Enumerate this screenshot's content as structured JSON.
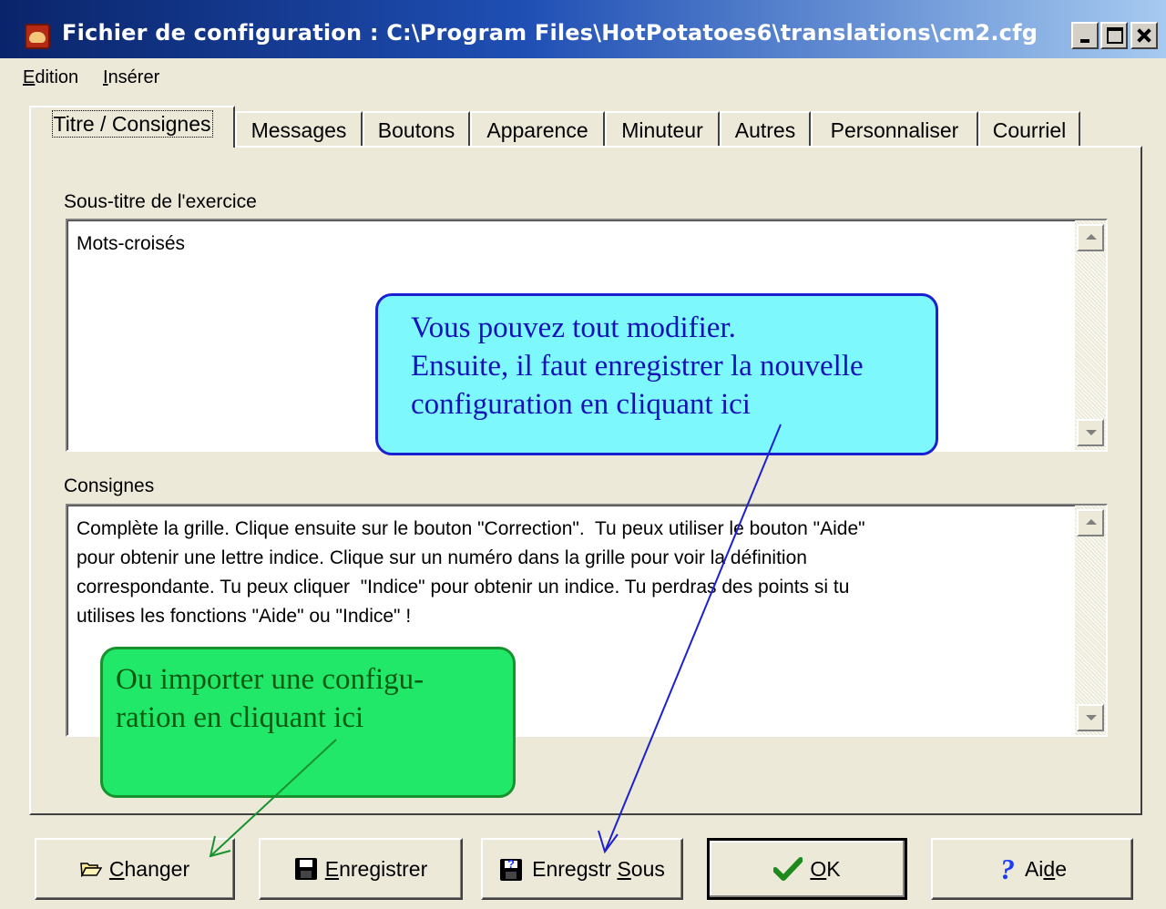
{
  "window": {
    "title": "Fichier de configuration : C:\\Program Files\\HotPotatoes6\\translations\\cm2.cfg"
  },
  "menu": {
    "items": [
      {
        "accel": "E",
        "rest": "dition"
      },
      {
        "accel": "I",
        "rest": "nsérer"
      }
    ]
  },
  "tabs": [
    {
      "label": "Titre / Consignes",
      "active": true
    },
    {
      "label": "Messages"
    },
    {
      "label": "Boutons"
    },
    {
      "label": "Apparence"
    },
    {
      "label": "Minuteur"
    },
    {
      "label": "Autres"
    },
    {
      "label": "Personnaliser"
    },
    {
      "label": "Courriel"
    }
  ],
  "subtitle": {
    "label": "Sous-titre de l'exercice",
    "value": "Mots-croisés"
  },
  "instructions": {
    "label": "Consignes",
    "value": "Complète la grille. Clique ensuite sur le bouton \"Correction\".  Tu peux utiliser le bouton \"Aide\"\npour obtenir une lettre indice. Clique sur un numéro dans la grille pour voir la définition\ncorrespondante. Tu peux cliquer  \"Indice\" pour obtenir un indice. Tu perdras des points si tu\nutilises les fonctions \"Aide\" ou \"Indice\" !"
  },
  "callouts": {
    "save": {
      "lines": [
        "Vous pouvez tout modifier.",
        "Ensuite, il faut enregistrer la nouvelle",
        "configuration en cliquant ici"
      ],
      "fill": "#7df8fc",
      "border": "#1c20d0",
      "text_color": "#1212b8"
    },
    "import": {
      "lines": [
        "Ou importer une configu-",
        "ration en cliquant ici"
      ],
      "fill": "#22e86a",
      "border": "#17922f",
      "text_color": "#0c5a12"
    }
  },
  "buttons": {
    "change": {
      "accel": "C",
      "rest": "hanger",
      "icon": "folder-open-icon"
    },
    "save": {
      "accel": "E",
      "rest": "nregistrer",
      "icon": "floppy-disk-icon"
    },
    "save_as": {
      "before": "Enregstr ",
      "accel": "S",
      "rest": "ous",
      "icon": "save-as-icon"
    },
    "ok": {
      "accel": "O",
      "rest": "K",
      "icon": "checkmark-icon"
    },
    "help": {
      "before": "Ai",
      "accel": "d",
      "rest": "e",
      "icon": "help-question-icon"
    }
  },
  "colors": {
    "titlebar_start": "#0a246a",
    "titlebar_end": "#a6caf0",
    "face": "#ece9d8",
    "arrow_blue": "#1c20d0",
    "arrow_green": "#17922f"
  }
}
